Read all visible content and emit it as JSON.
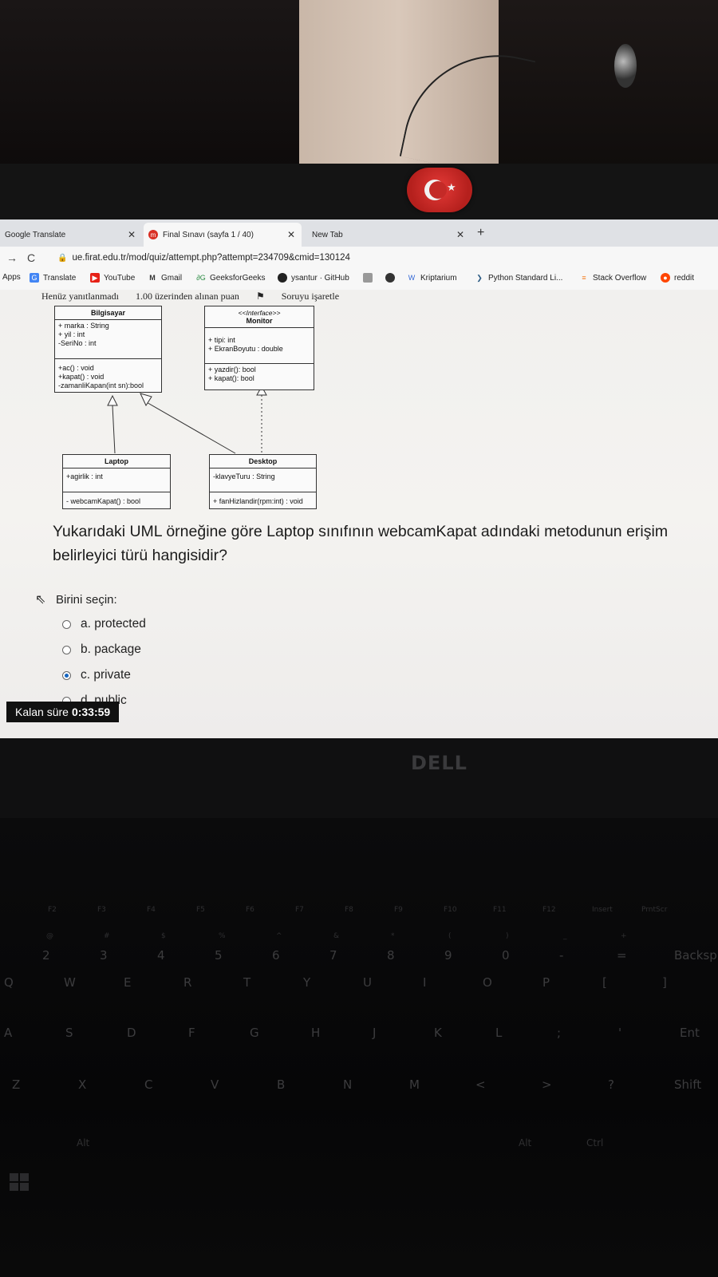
{
  "browser": {
    "tabs": [
      {
        "title": "Google Translate",
        "active": false
      },
      {
        "title": "Final Sınavı (sayfa 1 / 40)",
        "active": true
      },
      {
        "title": "New Tab",
        "active": false
      }
    ],
    "new_tab_symbol": "+",
    "url": "ue.firat.edu.tr/mod/quiz/attempt.php?attempt=234709&cmid=130124",
    "bookmarks": [
      "Apps",
      "Translate",
      "YouTube",
      "Gmail",
      "GeeksforGeeks",
      "ysantur · GitHub",
      "Kriptarium",
      "Python Standard Li...",
      "Stack Overflow",
      "reddit"
    ]
  },
  "quiz": {
    "status": "Henüz yanıtlanmadı",
    "points": "1.00 üzerinden alınan puan",
    "flag_label": "Soruyu işaretle",
    "uml": {
      "bilgisayar": {
        "name": "Bilgisayar",
        "attributes": [
          "+ marka : String",
          "+ yil : int",
          "-SeriNo : int"
        ],
        "methods": [
          "+ac() : void",
          "+kapat() : void",
          "-zamanliKapan(int sn):bool"
        ]
      },
      "monitor": {
        "stereotype": "<<Interface>>",
        "name": "Monitor",
        "attributes": [
          "+ tipi: int",
          "+ EkranBoyutu : double"
        ],
        "methods": [
          "+ yazdir(): bool",
          "+ kapat(): bool"
        ]
      },
      "laptop": {
        "name": "Laptop",
        "attributes": [
          "+agirlik : int"
        ],
        "methods": [
          "- webcamKapat() : bool"
        ]
      },
      "desktop": {
        "name": "Desktop",
        "attributes": [
          "-klavyeTuru : String"
        ],
        "methods": [
          "+ fanHizlandir(rpm:int) : void"
        ]
      }
    },
    "question": "Yukarıdaki UML örneğine göre Laptop sınıfının webcamKapat adındaki metodunun erişim belirleyici türü hangisidir?",
    "prompt": "Birini seçin:",
    "options": [
      {
        "label": "a. protected",
        "selected": false
      },
      {
        "label": "b. package",
        "selected": false
      },
      {
        "label": "c. private",
        "selected": true
      },
      {
        "label": "d. public",
        "selected": false
      }
    ],
    "timer_label": "Kalan süre",
    "timer_value": "0:33:59"
  },
  "device": {
    "brand": "DELL",
    "keys": {
      "fn_row": [
        "F2",
        "F3",
        "F4",
        "F5",
        "F6",
        "F7",
        "F8",
        "F9",
        "F10",
        "F11",
        "F12",
        "Insert",
        "PrntScr"
      ],
      "num_row": [
        "2",
        "3",
        "4",
        "5",
        "6",
        "7",
        "8",
        "9",
        "0",
        "-",
        "=",
        "Backsp"
      ],
      "num_row_shift": [
        "@",
        "#",
        "$",
        "%",
        "^",
        "&",
        "*",
        "(",
        ")",
        "_",
        "+"
      ],
      "top_row": [
        "Q",
        "W",
        "E",
        "R",
        "T",
        "Y",
        "U",
        "I",
        "O",
        "P",
        "[",
        "]"
      ],
      "home_row": [
        "A",
        "S",
        "D",
        "F",
        "G",
        "H",
        "J",
        "K",
        "L",
        ";",
        "'",
        "Ent"
      ],
      "bottom_row": [
        "Z",
        "X",
        "C",
        "V",
        "B",
        "N",
        "M",
        "<",
        ">",
        "?",
        "Shift"
      ],
      "mods": [
        "Alt",
        "Alt",
        "Ctrl"
      ]
    }
  },
  "colors": {
    "accent": "#1565c0",
    "timer_bg": "#111111",
    "flag_red": "#c42a27"
  }
}
